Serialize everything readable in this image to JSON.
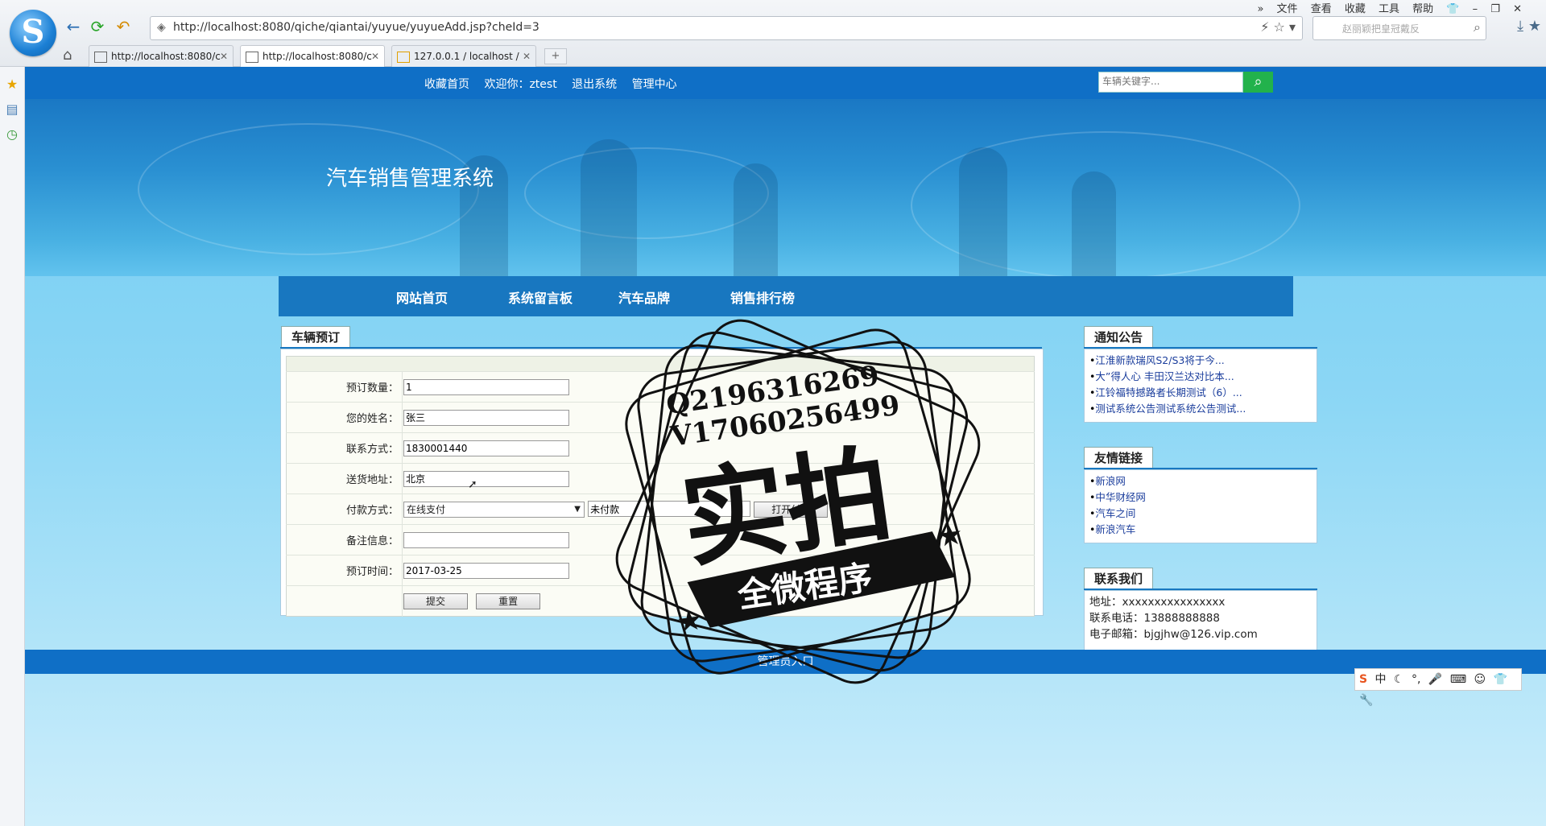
{
  "browser": {
    "url": "http://localhost:8080/qiche/qiantai/yuyue/yuyueAdd.jsp?cheId=3",
    "search_placeholder": "赵丽颖把皇冠戴反",
    "menu": [
      "文件",
      "查看",
      "收藏",
      "工具",
      "帮助"
    ],
    "tabs": [
      {
        "label": "http://localhost:8080/c"
      },
      {
        "label": "http://localhost:8080/c"
      },
      {
        "label": "127.0.0.1 / localhost /"
      }
    ]
  },
  "site": {
    "top_links": [
      "收藏首页",
      "欢迎你：ztest",
      "退出系统",
      "管理中心"
    ],
    "search_placeholder": "车辆关键字...",
    "title": "汽车销售管理系统",
    "nav": [
      "网站首页",
      "系统留言板",
      "汽车品牌",
      "销售排行榜"
    ],
    "footer": "管理员入口"
  },
  "form": {
    "title": "车辆预订",
    "quantity_label": "预订数量：",
    "quantity_value": "1",
    "name_label": "您的姓名：",
    "name_value": "张三",
    "phone_label": "联系方式：",
    "phone_value": "1830001440",
    "address_label": "送货地址：",
    "address_value": "北京",
    "payment_label": "付款方式：",
    "payment_value": "在线支付",
    "payment_status": "未付款",
    "open_pay_label": "打开付款",
    "note_label": "备注信息：",
    "note_value": "",
    "date_label": "预订时间：",
    "date_value": "2017-03-25",
    "submit_label": "提交",
    "reset_label": "重置"
  },
  "notices": {
    "title": "通知公告",
    "items": [
      "江淮新款瑞风S2/S3将于今...",
      "大”得人心 丰田汉兰达对比本...",
      "江铃福特撼路者长期测试（6）...",
      "测试系统公告测试系统公告测试..."
    ]
  },
  "links": {
    "title": "友情链接",
    "items": [
      "新浪网",
      "中华财经网",
      "汽车之间",
      "新浪汽车"
    ]
  },
  "contact": {
    "title": "联系我们",
    "address": "地址：xxxxxxxxxxxxxxxx",
    "phone": "联系电话：13888888888",
    "email": "电子邮箱：bjgjhw@126.vip.com"
  },
  "watermark": {
    "line1": "Q2196316269",
    "line2": "V17060256499",
    "big": "实拍",
    "banner": "全微程序"
  },
  "ime": {
    "label": "中"
  }
}
